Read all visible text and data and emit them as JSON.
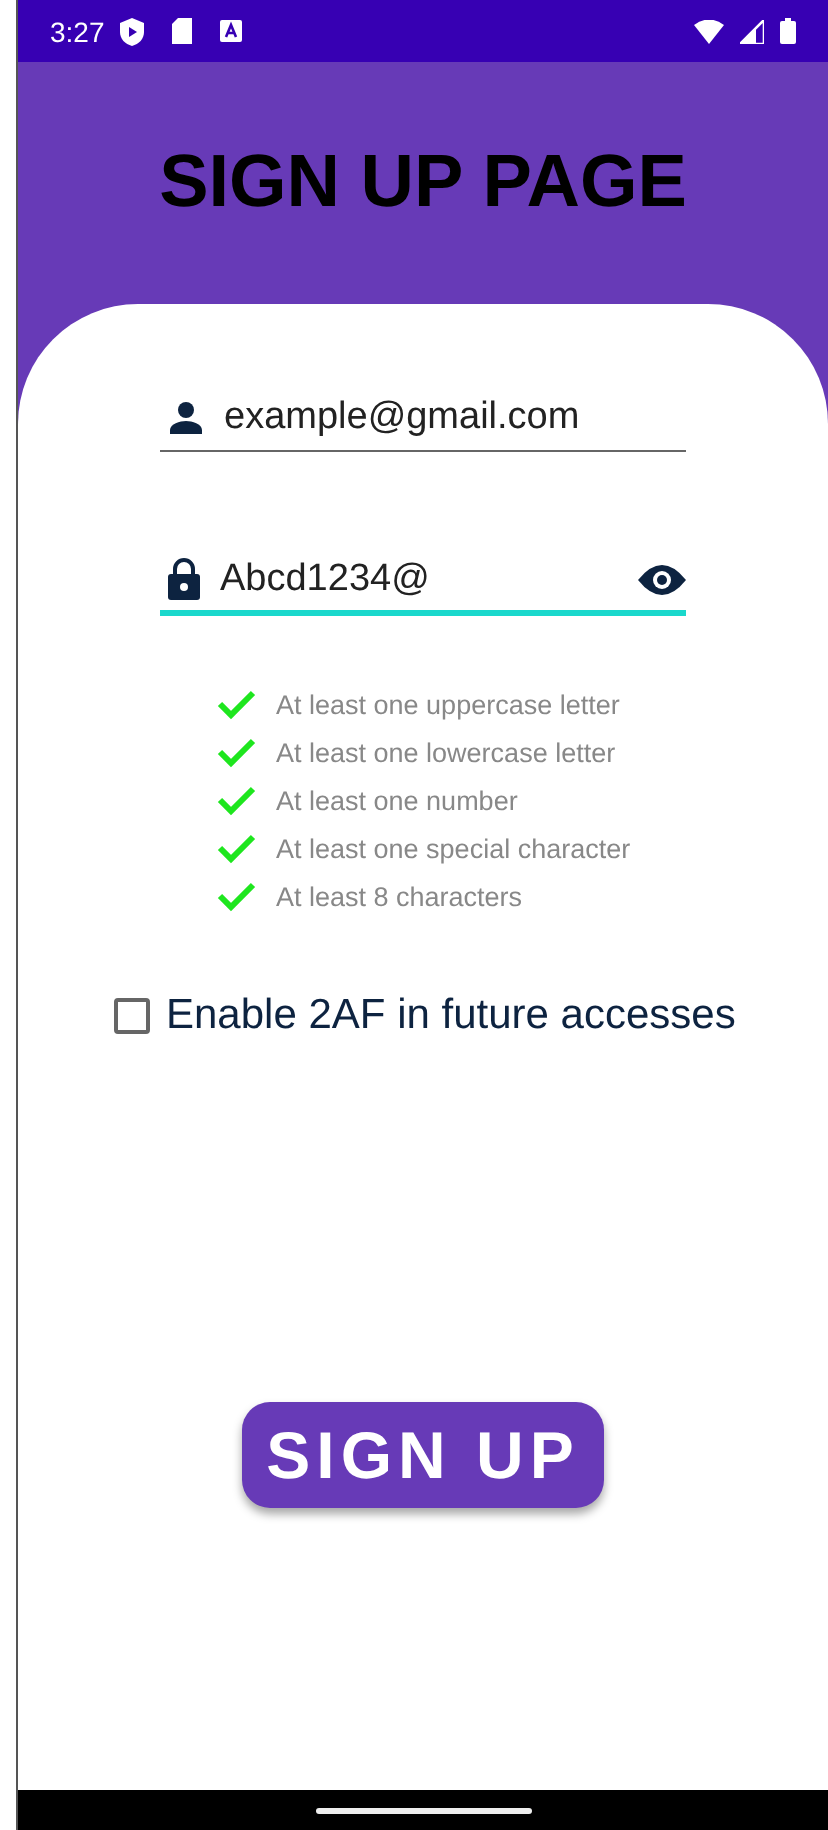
{
  "status_bar": {
    "time": "3:27"
  },
  "title": "SIGN UP PAGE",
  "email_field": {
    "value": "example@gmail.com",
    "focused": false
  },
  "password_field": {
    "value": "Abcd1234@",
    "focused": true
  },
  "requirements": [
    {
      "label": "At least one uppercase letter",
      "met": true
    },
    {
      "label": "At least one lowercase letter",
      "met": true
    },
    {
      "label": "At least one number",
      "met": true
    },
    {
      "label": "At least one special character",
      "met": true
    },
    {
      "label": "At least 8 characters",
      "met": true
    }
  ],
  "two_factor": {
    "label": "Enable 2AF in future accesses",
    "checked": false
  },
  "signup_button": "SIGN UP"
}
